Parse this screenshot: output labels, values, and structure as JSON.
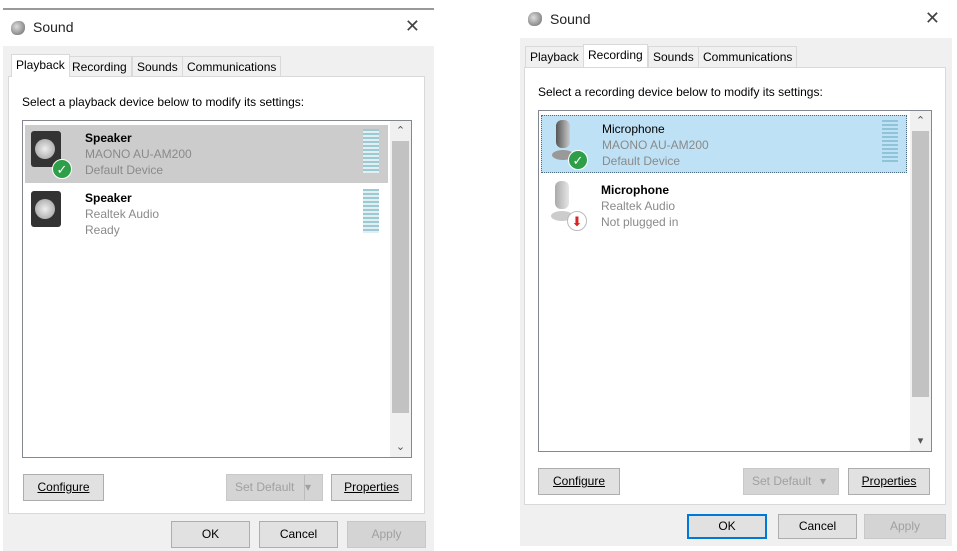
{
  "dialogs": [
    {
      "title": "Sound",
      "tabs": [
        "Playback",
        "Recording",
        "Sounds",
        "Communications"
      ],
      "active_tab": "Playback",
      "instruction": "Select a playback device below to modify its settings:",
      "devices": [
        {
          "name": "Speaker",
          "description": "MAONO AU-AM200",
          "status": "Default Device",
          "selected": true
        },
        {
          "name": "Speaker",
          "description": "Realtek Audio",
          "status": "Ready",
          "selected": false
        }
      ],
      "buttons": {
        "configure": "Configure",
        "set_default": "Set Default",
        "properties": "Properties",
        "ok": "OK",
        "cancel": "Cancel",
        "apply": "Apply"
      }
    },
    {
      "title": "Sound",
      "tabs": [
        "Playback",
        "Recording",
        "Sounds",
        "Communications"
      ],
      "active_tab": "Recording",
      "instruction": "Select a recording device below to modify its settings:",
      "devices": [
        {
          "name": "Microphone",
          "description": "MAONO AU-AM200",
          "status": "Default Device",
          "selected": true
        },
        {
          "name": "Microphone",
          "description": "Realtek Audio",
          "status": "Not plugged in",
          "selected": false
        }
      ],
      "buttons": {
        "configure": "Configure",
        "set_default": "Set Default",
        "properties": "Properties",
        "ok": "OK",
        "cancel": "Cancel",
        "apply": "Apply"
      }
    }
  ],
  "colors": {
    "default_badge": "#2e9e48",
    "unplugged_badge": "#d92323",
    "selection_playback": "#cccccc",
    "selection_recording": "#bfe1f5"
  }
}
